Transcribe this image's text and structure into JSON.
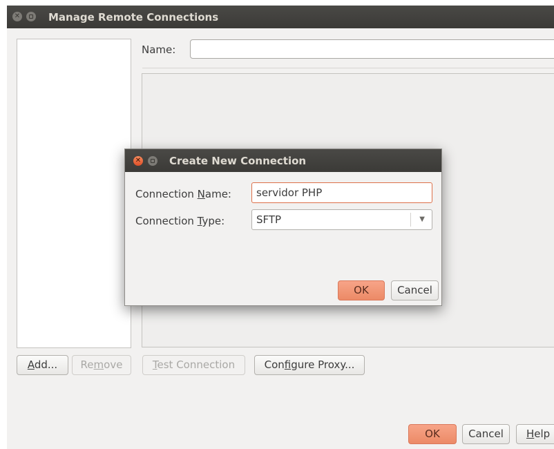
{
  "window": {
    "title": "Manage Remote Connections"
  },
  "form": {
    "name_label": "Name:",
    "name_value": ""
  },
  "left_buttons": {
    "add": {
      "pre": "",
      "mnemonic": "A",
      "post": "dd..."
    },
    "remove": {
      "pre": "Re",
      "mnemonic": "m",
      "post": "ove"
    }
  },
  "right_buttons": {
    "test": {
      "pre": "",
      "mnemonic": "T",
      "post": "est Connection"
    },
    "proxy": {
      "pre": "Con",
      "mnemonic": "f",
      "post": "igure Proxy..."
    }
  },
  "footer": {
    "ok": "OK",
    "cancel": "Cancel",
    "help": {
      "pre": "",
      "mnemonic": "H",
      "post": "elp"
    }
  },
  "dialog": {
    "title": "Create New Connection",
    "name_label": {
      "pre": "Connection ",
      "mnemonic": "N",
      "post": "ame:"
    },
    "type_label": {
      "pre": "Connection ",
      "mnemonic": "T",
      "post": "ype:"
    },
    "name_value": "servidor PHP",
    "type_value": "SFTP",
    "ok": "OK",
    "cancel": "Cancel"
  },
  "colors": {
    "titlebar": "#3b3a37",
    "window_bg": "#f2f1f0",
    "accent": "#ec8a66"
  }
}
